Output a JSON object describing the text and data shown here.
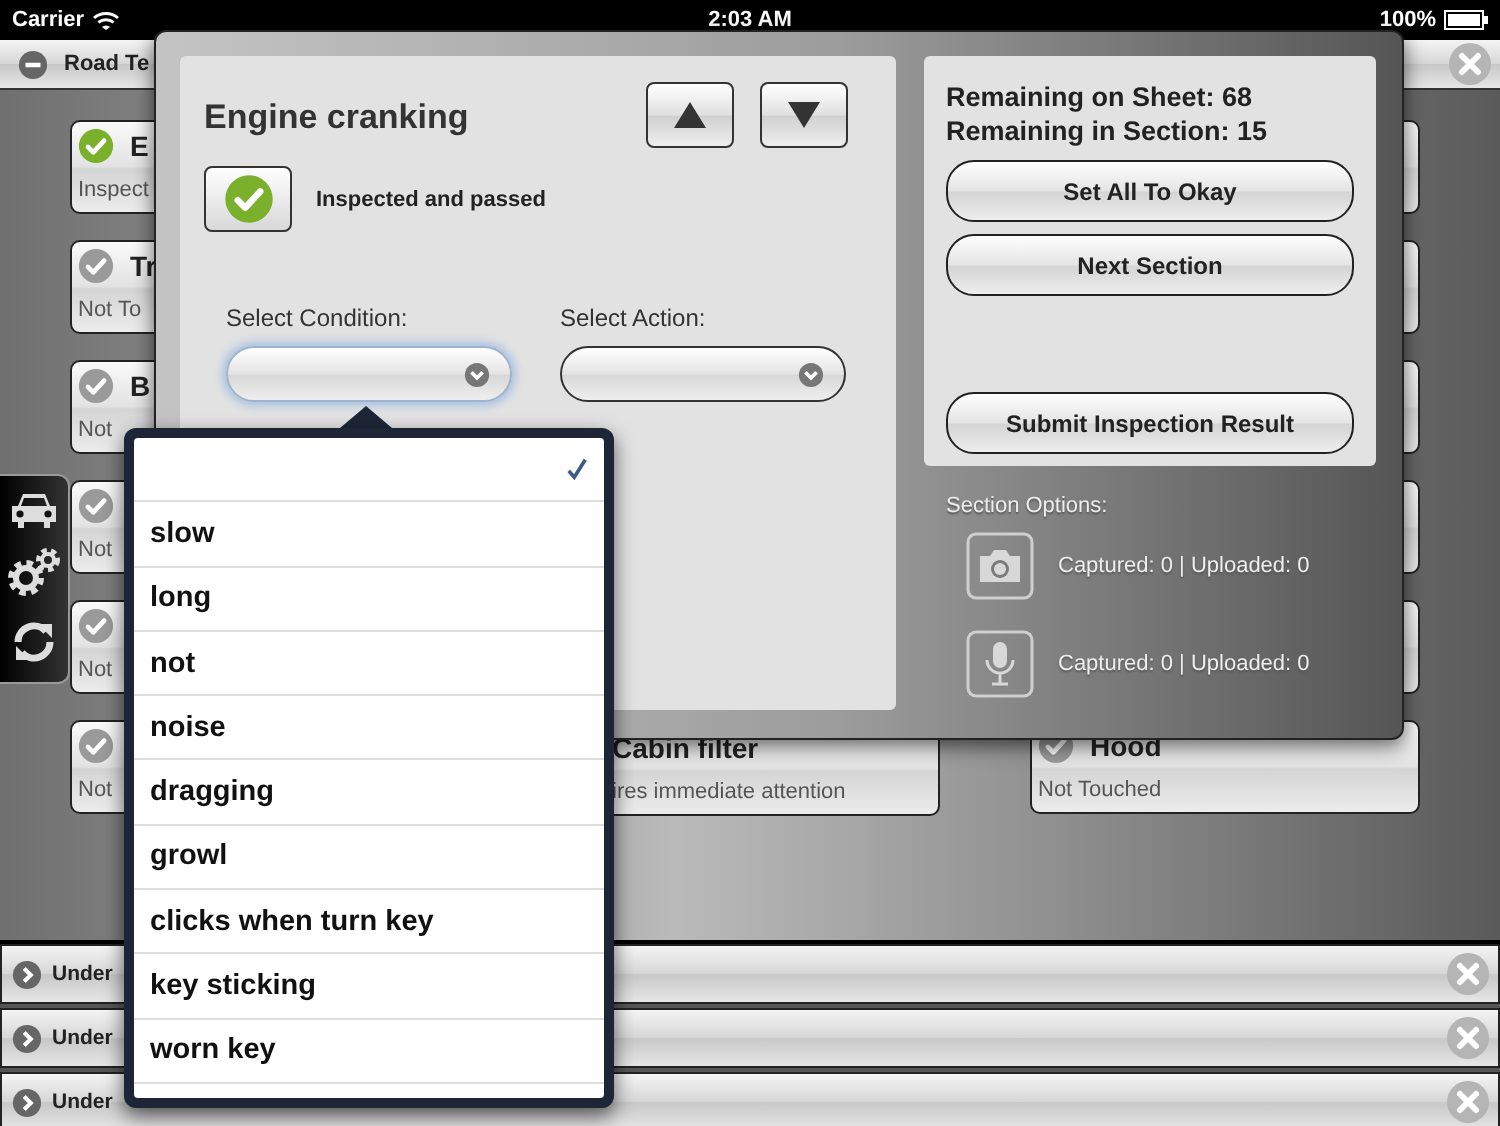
{
  "status_bar": {
    "carrier": "Carrier",
    "time": "2:03 AM",
    "battery": "100%"
  },
  "sections_top": [
    {
      "title": "Road Te",
      "expanded": true
    }
  ],
  "columns": [
    {
      "items": [
        {
          "kind": "item",
          "title": "E",
          "subtitle": "Inspect",
          "passed": true
        },
        {
          "kind": "item",
          "title": "Tr",
          "subtitle": "Not To",
          "passed": false
        },
        {
          "kind": "item",
          "title": "B",
          "subtitle": "Not",
          "passed": false
        },
        {
          "kind": "item",
          "subtitle": "Not",
          "passed": false
        },
        {
          "kind": "item",
          "subtitle": "Not",
          "passed": false
        },
        {
          "kind": "item",
          "subtitle": "Not",
          "passed": false
        }
      ]
    },
    {
      "items": [
        {
          "kind": "item",
          "title": "Cabin filter",
          "subtitle": "ires immediate attention"
        }
      ]
    },
    {
      "items": [
        {
          "kind": "blank"
        },
        {
          "kind": "blank"
        },
        {
          "kind": "blank"
        },
        {
          "kind": "blank"
        },
        {
          "kind": "blank"
        },
        {
          "kind": "item",
          "title": "Hood",
          "subtitle": "Not Touched",
          "passed": false
        }
      ]
    }
  ],
  "sections_bottom": [
    {
      "title": "Under",
      "expanded": false
    },
    {
      "title": "Under",
      "expanded": false
    },
    {
      "title": "Under",
      "expanded": false
    }
  ],
  "side_toolbar": [
    {
      "kind": "car"
    },
    {
      "kind": "gears"
    },
    {
      "kind": "refresh"
    }
  ],
  "editor": {
    "title": "Engine cranking",
    "passed": true,
    "passed_label": "Inspected and passed",
    "condition": {
      "label": "Select Condition:",
      "focused": true
    },
    "action": {
      "label": "Select Action:",
      "focused": false
    }
  },
  "summary": {
    "lines": [
      "Remaining on Sheet: 68",
      "Remaining in Section: 15"
    ],
    "buttons": [
      "Set All To Okay",
      "Next Section"
    ],
    "submit": "Submit Inspection Result"
  },
  "section_options": {
    "label": "Section Options:",
    "media": [
      {
        "kind": "camera",
        "text": "Captured: 0 | Uploaded: 0"
      },
      {
        "kind": "mic",
        "text": "Captured: 0 | Uploaded: 0"
      }
    ]
  },
  "condition_options": [
    {
      "selected": true
    },
    {
      "label": "slow",
      "selected": false
    },
    {
      "label": "long",
      "selected": false
    },
    {
      "label": "not",
      "selected": false
    },
    {
      "label": "noise",
      "selected": false
    },
    {
      "label": "dragging",
      "selected": false
    },
    {
      "label": "growl",
      "selected": false
    },
    {
      "label": "clicks when turn key",
      "selected": false
    },
    {
      "label": "key sticking",
      "selected": false
    },
    {
      "label": "worn key",
      "selected": false
    }
  ]
}
